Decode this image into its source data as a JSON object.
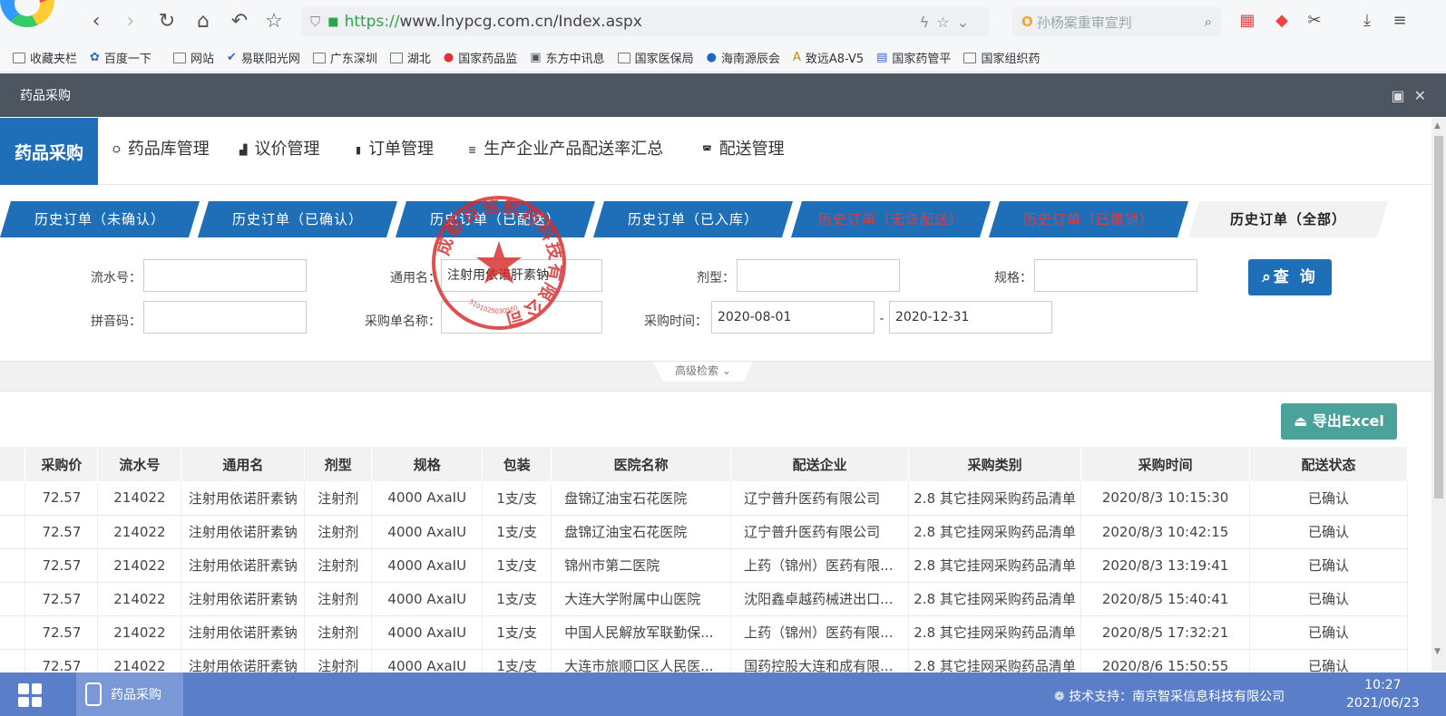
{
  "browser": {
    "url_https": "https://",
    "url_rest": "www.lnypcg.com.cn/Index.aspx",
    "search_text": "孙杨案重审宣判",
    "bookmarks": [
      "收藏夹栏",
      "百度一下",
      "网站",
      "易联阳光网",
      "广东深圳",
      "湖北",
      "国家药品监",
      "东方中讯息",
      "国家医保局",
      "海南源辰会",
      "致远A8-V5",
      "国家药管平",
      "国家组织药"
    ]
  },
  "app": {
    "title": "药品采购",
    "brand": "药品采购",
    "menu": [
      "药品库管理",
      "议价管理",
      "订单管理",
      "生产企业产品配送率汇总",
      "配送管理"
    ]
  },
  "tabs": [
    {
      "label": "历史订单（未确认）",
      "style": "normal"
    },
    {
      "label": "历史订单（已确认）",
      "style": "normal"
    },
    {
      "label": "历史订单（已配送）",
      "style": "normal"
    },
    {
      "label": "历史订单（已入库）",
      "style": "normal"
    },
    {
      "label": "历史订单（无法配送）",
      "style": "red"
    },
    {
      "label": "历史订单（已撤销）",
      "style": "red"
    },
    {
      "label": "历史订单（全部）",
      "style": "active"
    }
  ],
  "filters": {
    "serial_label": "流水号：",
    "generic_label": "通用名：",
    "generic_value": "注射用依诺肝素钠",
    "form_label": "剂型：",
    "spec_label": "规格：",
    "pinyin_label": "拼音码：",
    "order_name_label": "采购单名称：",
    "time_label": "采购时间：",
    "date_from": "2020-08-01",
    "date_sep": "-",
    "date_to": "2020-12-31",
    "query_button": "查 询",
    "advanced": "高级检索"
  },
  "export_label": "导出Excel",
  "table": {
    "columns": [
      "采购价",
      "流水号",
      "通用名",
      "剂型",
      "规格",
      "包装",
      "医院名称",
      "配送企业",
      "采购类别",
      "采购时间",
      "配送状态"
    ],
    "rows": [
      [
        "72.57",
        "214022",
        "注射用依诺肝素钠",
        "注射剂",
        "4000 AxaIU",
        "1支/支",
        "盘锦辽油宝石花医院",
        "辽宁普升医药有限公司",
        "2.8 其它挂网采购药品清单",
        "2020/8/3 10:15:30",
        "已确认"
      ],
      [
        "72.57",
        "214022",
        "注射用依诺肝素钠",
        "注射剂",
        "4000 AxaIU",
        "1支/支",
        "盘锦辽油宝石花医院",
        "辽宁普升医药有限公司",
        "2.8 其它挂网采购药品清单",
        "2020/8/3 10:42:15",
        "已确认"
      ],
      [
        "72.57",
        "214022",
        "注射用依诺肝素钠",
        "注射剂",
        "4000 AxaIU",
        "1支/支",
        "锦州市第二医院",
        "上药（锦州）医药有限...",
        "2.8 其它挂网采购药品清单",
        "2020/8/3 13:19:41",
        "已确认"
      ],
      [
        "72.57",
        "214022",
        "注射用依诺肝素钠",
        "注射剂",
        "4000 AxaIU",
        "1支/支",
        "大连大学附属中山医院",
        "沈阳鑫卓越药械进出口...",
        "2.8 其它挂网采购药品清单",
        "2020/8/5 15:40:41",
        "已确认"
      ],
      [
        "72.57",
        "214022",
        "注射用依诺肝素钠",
        "注射剂",
        "4000 AxaIU",
        "1支/支",
        "中国人民解放军联勤保...",
        "上药（锦州）医药有限...",
        "2.8 其它挂网采购药品清单",
        "2020/8/5 17:32:21",
        "已确认"
      ],
      [
        "72.57",
        "214022",
        "注射用依诺肝素钠",
        "注射剂",
        "4000 AxaIU",
        "1支/支",
        "大连市旅顺口区人民医...",
        "国药控股大连和成有限...",
        "2.8 其它挂网采购药品清单",
        "2020/8/6 15:50:55",
        "已确认"
      ]
    ]
  },
  "stamp": {
    "text": "成都百信航药科技有限公司",
    "number": "5101025030560"
  },
  "taskbar": {
    "app_label": "药品采购",
    "support": "技术支持：南京智采信息科技有限公司",
    "time": "10:27",
    "date": "2021/06/23"
  },
  "colors": {
    "primary": "#1f6fb8",
    "export": "#4aa29a",
    "stamp": "#d62b2b",
    "taskbar": "#5a7fc8"
  }
}
